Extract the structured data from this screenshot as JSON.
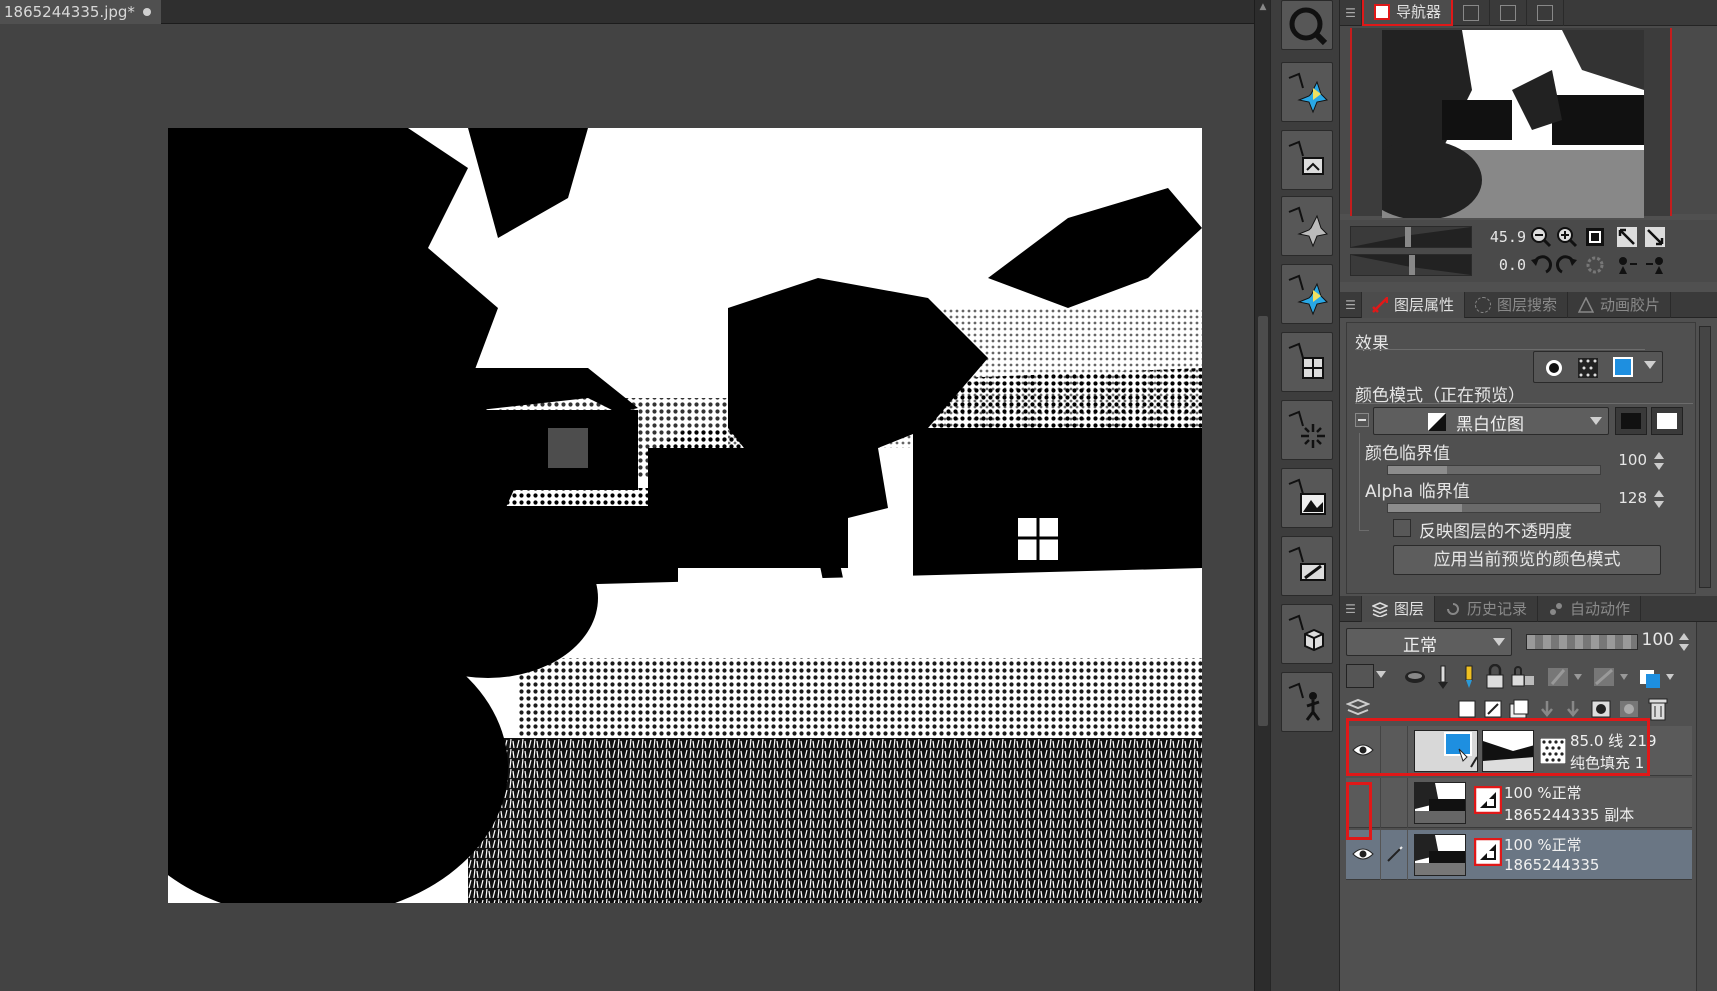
{
  "document": {
    "tab_title": "1865244335.jpg*"
  },
  "tools": [
    {
      "name": "zoom-tool",
      "icon": "magnifier-icon"
    },
    {
      "name": "sub-tool-blend",
      "icon": "pinwheel-icon"
    },
    {
      "name": "sub-tool-image",
      "icon": "image-frame-icon"
    },
    {
      "name": "sub-tool-pinwheel-gray",
      "icon": "pinwheel-gray-icon"
    },
    {
      "name": "sub-tool-pinwheel-blue",
      "icon": "pinwheel-icon"
    },
    {
      "name": "sub-tool-grid",
      "icon": "grid-icon"
    },
    {
      "name": "sub-tool-burst",
      "icon": "burst-icon"
    },
    {
      "name": "sub-tool-mountain",
      "icon": "mountain-icon"
    },
    {
      "name": "sub-tool-edit",
      "icon": "edit-icon"
    },
    {
      "name": "sub-tool-cube",
      "icon": "cube-icon"
    },
    {
      "name": "sub-tool-figure",
      "icon": "figure-icon"
    }
  ],
  "navigator": {
    "tab_label": "导航器",
    "zoom_value": "45.9",
    "rotate_value": "0.0"
  },
  "properties": {
    "tabs": [
      {
        "label": "图层属性",
        "active": true
      },
      {
        "label": "图层搜索",
        "active": false
      },
      {
        "label": "动画胶片",
        "active": false
      }
    ],
    "effect_label": "效果",
    "color_mode_label": "颜色模式（正在预览）",
    "color_mode_value": "黑白位图",
    "color_threshold_label": "颜色临界值",
    "color_threshold_value": "100",
    "color_threshold_fraction": 0.28,
    "alpha_threshold_label": "Alpha 临界值",
    "alpha_threshold_value": "128",
    "alpha_threshold_fraction": 0.35,
    "reflect_opacity_label": "反映图层的不透明度",
    "apply_button_label": "应用当前预览的颜色模式"
  },
  "layers_panel": {
    "tabs": [
      {
        "label": "图层",
        "active": true
      },
      {
        "label": "历史记录",
        "active": false
      },
      {
        "label": "自动动作",
        "active": false
      }
    ],
    "blend_mode": "正常",
    "opacity": "100",
    "layers": [
      {
        "line1": "85.0 线 219",
        "line2": "纯色填充 1",
        "visible": true,
        "selected": false,
        "type": "fill"
      },
      {
        "line1": "100 %正常",
        "line2": "1865244335 副本",
        "visible": false,
        "selected": false,
        "type": "raster"
      },
      {
        "line1": "100 %正常",
        "line2": "1865244335",
        "visible": true,
        "selected": true,
        "type": "raster"
      }
    ]
  },
  "colors": {
    "accent_red": "#e01818",
    "accent_blue": "#1e8fe0",
    "selected_layer": "#6a7684"
  }
}
